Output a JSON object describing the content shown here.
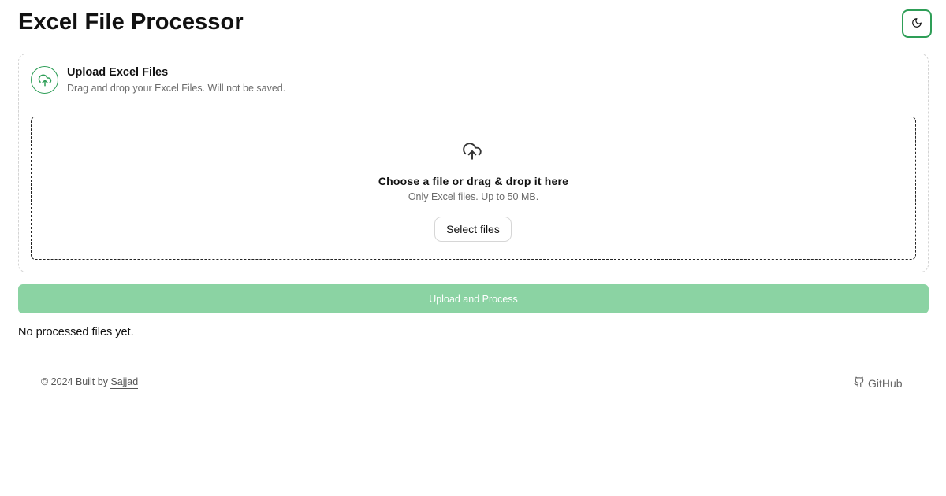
{
  "header": {
    "title": "Excel File Processor",
    "theme_toggle_icon": "moon-icon"
  },
  "upload_card": {
    "icon": "cloud-upload-icon",
    "title": "Upload Excel Files",
    "subtitle": "Drag and drop your Excel Files. Will not be saved.",
    "dropzone": {
      "icon": "cloud-upload-icon",
      "title": "Choose a file or drag & drop it here",
      "subtitle": "Only Excel files. Up to 50 MB.",
      "select_label": "Select files"
    }
  },
  "process_button_label": "Upload and Process",
  "processed_files": {
    "empty_message": "No processed files yet."
  },
  "footer": {
    "copyright_prefix": "© 2024 Built by",
    "author": "Sajjad",
    "github_label": "GitHub",
    "github_icon": "github-icon"
  },
  "colors": {
    "accent": "#2e9e57",
    "process_button_bg": "#8bd3a3",
    "muted_text": "#6b6b6b"
  }
}
